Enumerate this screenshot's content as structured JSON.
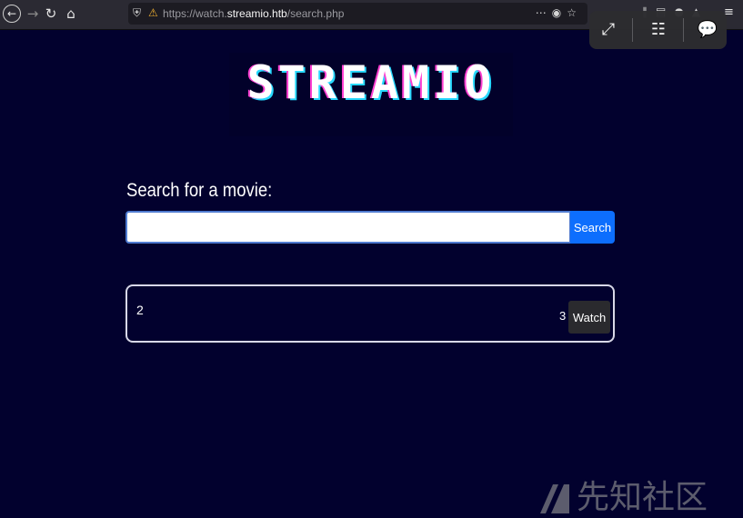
{
  "browser": {
    "url_scheme": "https://watch.",
    "url_host": "streamio.htb",
    "url_path": "/search.php",
    "icons": {
      "back": "back-arrow-icon",
      "forward": "forward-arrow-icon",
      "reload": "reload-icon",
      "home": "home-icon",
      "shield": "shield-icon",
      "lock": "lock-warning-icon",
      "more": "more-icon",
      "pocket": "pocket-icon",
      "bookmark": "star-icon",
      "library": "library-icon",
      "sidebar": "sidebar-icon",
      "account": "account-icon",
      "extension": "extension-icon",
      "menu": "hamburger-menu-icon"
    }
  },
  "overlay": {
    "icons": [
      "expand-icon",
      "text-scan-icon",
      "chat-icon"
    ]
  },
  "page": {
    "logo_text": "STREAMIO",
    "search_label": "Search for a movie:",
    "search_value": "",
    "search_button": "Search",
    "results": [
      {
        "title": "2",
        "count": "3",
        "action": "Watch"
      }
    ]
  },
  "watermark": {
    "text": "先知社区"
  },
  "colors": {
    "page_bg": "#02012e",
    "accent": "#0d6efd",
    "logo_pink": "#ff3fd2",
    "logo_cyan": "#27d9ff"
  }
}
